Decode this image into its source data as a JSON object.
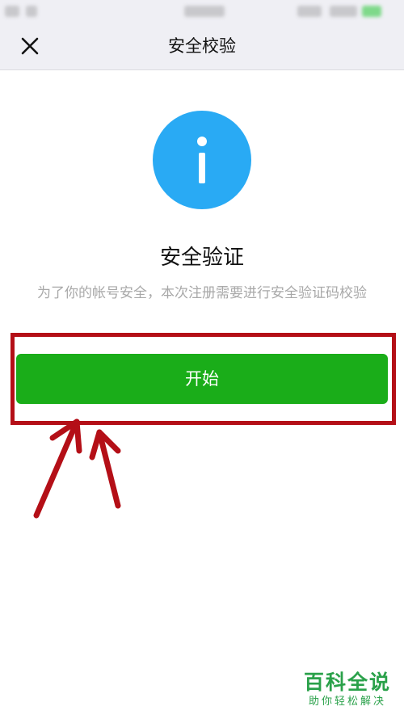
{
  "nav": {
    "title": "安全校验",
    "close_icon": "close-icon"
  },
  "main": {
    "icon": "info-icon",
    "icon_color": "#29aaf4",
    "title": "安全验证",
    "description": "为了你的帐号安全，本次注册需要进行安全验证码校验",
    "start_button_label": "开始",
    "button_color": "#1aad19"
  },
  "annotation": {
    "highlight_color": "#b40f17"
  },
  "watermark": {
    "main": "百科全说",
    "sub": "助你轻松解决"
  }
}
